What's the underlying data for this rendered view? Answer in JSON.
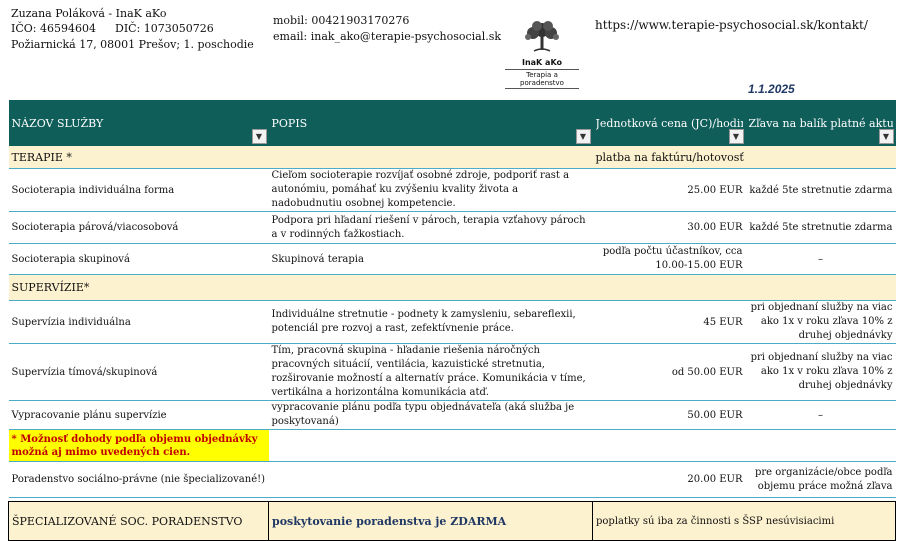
{
  "provider": {
    "name": "Zuzana Poláková - InaK aKo",
    "ico": "IČO: 46594604",
    "dic": "DIČ: 1073050726",
    "address": "Požiarnická 17, 08001 Prešov; 1. poschodie",
    "mobile": "mobil: 00421903170276",
    "email": "email: inak_ako@terapie-psychosocial.sk",
    "url": "https://www.terapie-psychosocial.sk/kontakt/"
  },
  "logo": {
    "name": "InaK aKo",
    "tagline": "Terapia a poradenstvo"
  },
  "date": "1.1.2025",
  "columns": [
    "NÁZOV SLUŽBY",
    "POPIS",
    "Jednotková cena (JC)/hodina",
    "Zľava na balík platné aktuálne"
  ],
  "categories": {
    "therapy": {
      "label": "TERAPIE *",
      "payment": "platba na faktúru/hotovosť"
    },
    "supervision": {
      "label": "SUPERVÍZIE*"
    }
  },
  "therapy_rows": [
    {
      "name": "Socioterapia individuálna forma",
      "desc": "Cieľom socioterapie rozvíjať osobné zdroje, podporiť rast a autonómiu, pomáhať ku zvýšeniu kvality života a nadobudnutiu osobnej kompetencie.",
      "price": "25.00 EUR",
      "discount": "každé 5te stretnutie zdarma"
    },
    {
      "name": "Socioterapia párová/viacosobová",
      "desc": "Podpora pri hľadaní riešení v pároch, terapia vzťahovy pároch a v rodinných ťažkostiach.",
      "price": "30.00 EUR",
      "discount": "každé 5te stretnutie zdarma"
    },
    {
      "name": "Socioterapia skupinová",
      "desc": "Skupinová terapia",
      "price": "podľa počtu účastníkov, cca 10.00-15.00 EUR",
      "discount": "–"
    }
  ],
  "supervision_rows": [
    {
      "name": "Supervízia individuálna",
      "desc": "Individuálne stretnutie - podnety k zamysleniu, sebareflexii, potenciál pre rozvoj a rast, zefektívnenie práce.",
      "price": "45 EUR",
      "discount": "pri objednaní služby na viac ako 1x v roku zľava 10% z druhej objednávky"
    },
    {
      "name": "Supervízia tímová/skupinová",
      "desc": "Tím, pracovná skupina - hľadanie riešenia náročných pracovných situácií, ventilácia, kazuistické stretnutia, rozširovanie možností a alternatív práce. Komunikácia v tíme, vertikálna a horizontálna komunikácia atď.",
      "price": "od 50.00 EUR",
      "discount": "pri objednaní služby na viac ako 1x v roku zľava 10% z druhej objednávky"
    },
    {
      "name": "Vypracovanie plánu supervízie",
      "desc": "vypracovanie plánu podľa typu objednávateľa (aká služba je poskytovaná)",
      "price": "50.00 EUR",
      "discount": "–"
    }
  ],
  "note": "* Možnosť dohody podľa objemu objednávky možná aj mimo uvedených cien.",
  "legal_row": {
    "name": "Poradenstvo sociálno-právne (nie špecializované!)",
    "price": "20.00 EUR",
    "discount": "pre organizácie/obce podľa objemu práce možná zľava"
  },
  "special_row": {
    "name": "ŠPECIALIZOVANÉ SOC. PORADENSTVO",
    "free": "poskytovanie poradenstva je ZDARMA",
    "fees": "poplatky sú iba za činnosti s ŠSP nesúvisiacimi"
  }
}
